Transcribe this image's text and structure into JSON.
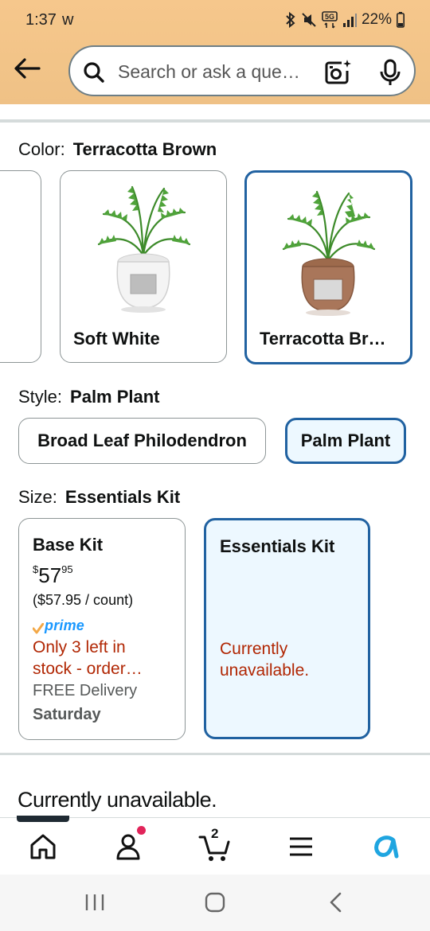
{
  "status_bar": {
    "time": "1:37",
    "carrier_glyph": "w",
    "battery": "22%",
    "icons": [
      "bluetooth-icon",
      "mute-icon",
      "5g-icon",
      "signal-icon",
      "battery-icon"
    ]
  },
  "header": {
    "back_icon": "arrow-left-icon",
    "search_placeholder": "Search or ask a que…",
    "camera_icon": "camera-search-icon",
    "mic_icon": "microphone-icon"
  },
  "color": {
    "label": "Color:",
    "selected": "Terracotta Brown",
    "options": [
      {
        "name": "Soft White",
        "selected": false
      },
      {
        "name": "Terracotta Br…",
        "selected": true
      }
    ]
  },
  "style": {
    "label": "Style:",
    "selected": "Palm Plant",
    "options": [
      {
        "name": "Broad Leaf Philodendron",
        "selected": false
      },
      {
        "name": "Palm Plant",
        "selected": true
      }
    ]
  },
  "size": {
    "label": "Size:",
    "selected": "Essentials Kit",
    "options": [
      {
        "name": "Base Kit",
        "price_currency": "$",
        "price_whole": "57",
        "price_fraction": "95",
        "unit_price": "($57.95 / count)",
        "prime": "prime",
        "stock_line1": "Only 3 left in",
        "stock_line2": "stock - order…",
        "delivery": "FREE Delivery",
        "delivery_day": "Saturday",
        "selected": false
      },
      {
        "name": "Essentials Kit",
        "status_line1": "Currently",
        "status_line2": "unavailable.",
        "selected": true
      }
    ]
  },
  "availability": "Currently unavailable.",
  "bottom_nav": {
    "items": [
      "home-icon",
      "account-icon",
      "cart-icon",
      "menu-icon",
      "rufus-icon"
    ],
    "cart_count": "2"
  },
  "system_nav": [
    "recent-apps-icon",
    "home-button-icon",
    "back-chevron-icon"
  ],
  "colors": {
    "header_bg": "#f2c488",
    "selected_border": "#2162a1",
    "selected_bg": "#edf8ff",
    "error_red": "#b12704",
    "prime_blue": "#1a98ff",
    "notification_dot": "#e1245a"
  }
}
